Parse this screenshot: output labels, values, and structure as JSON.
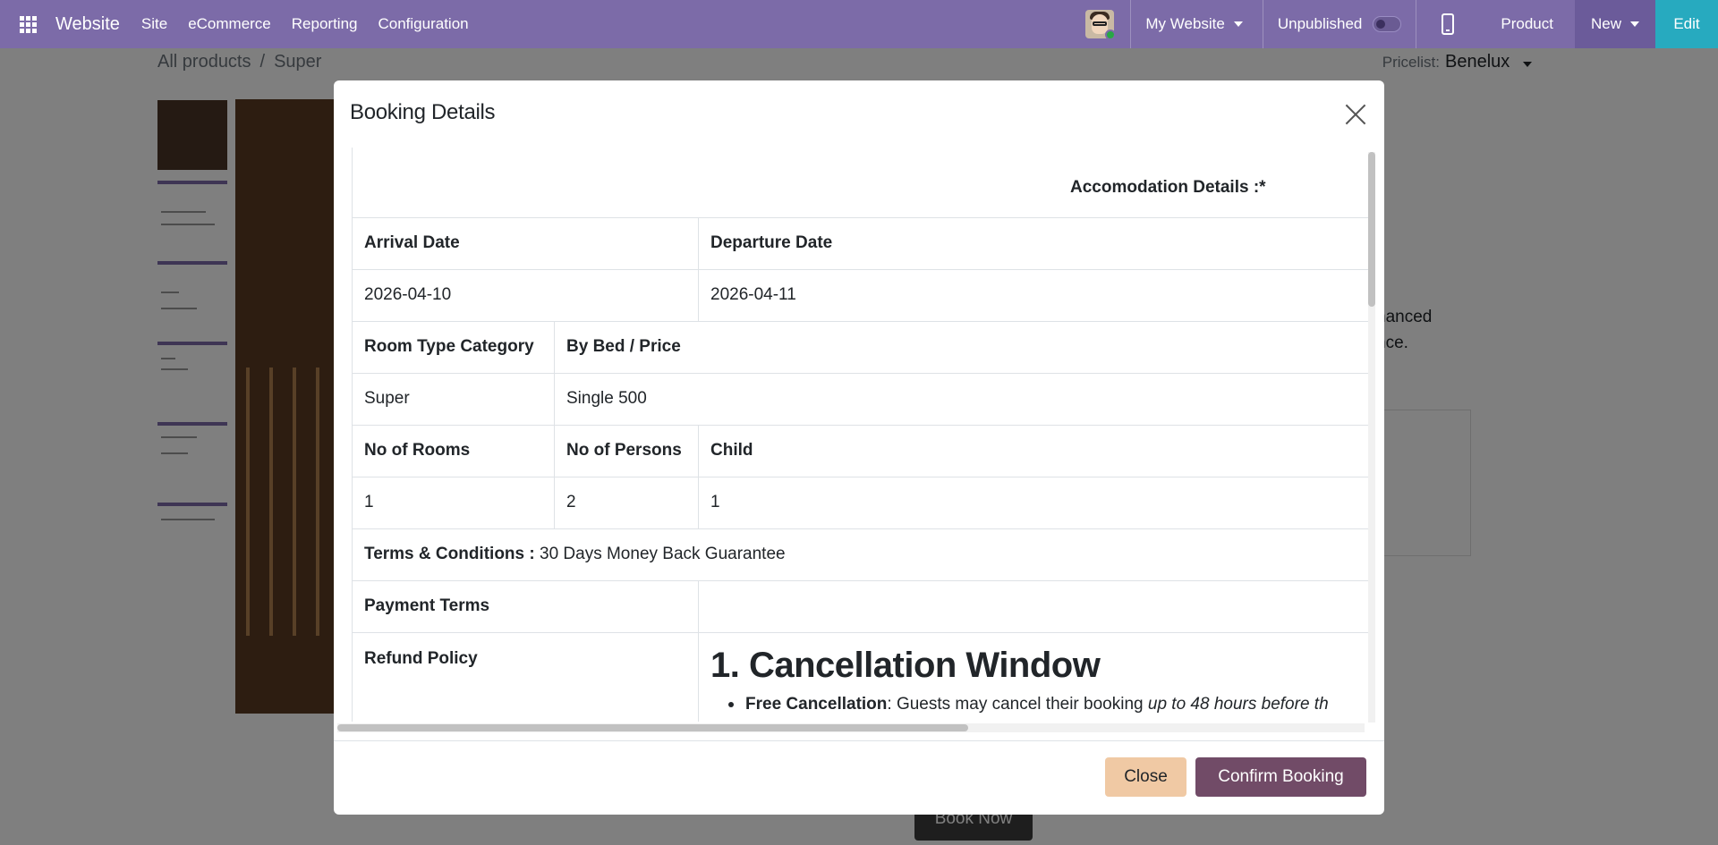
{
  "navbar": {
    "brand": "Website",
    "menu": [
      "Site",
      "eCommerce",
      "Reporting",
      "Configuration"
    ],
    "website_selector": "My Website",
    "publish_status": "Unpublished",
    "product_label": "Product",
    "new_label": "New",
    "edit_label": "Edit"
  },
  "page": {
    "breadcrumb": [
      "All products",
      "Super"
    ],
    "pricelist_label": "Pricelist:",
    "pricelist_value": "Benelux",
    "description_lines": [
      "hanced",
      "nce."
    ],
    "book_now_label": "Book Now"
  },
  "modal": {
    "title": "Booking Details",
    "accommodation_heading": "Accomodation Details :*",
    "arrival_label": "Arrival Date",
    "arrival_value": "2026-04-10",
    "departure_label": "Departure Date",
    "departure_value": "2026-04-11",
    "room_type_label": "Room Type Category",
    "price_label": "By Bed / Price",
    "room_type_value": "Super",
    "price_value": "Single 500",
    "rooms_label": "No of Rooms",
    "persons_label": "No of Persons",
    "child_label": "Child",
    "rooms_value": "1",
    "persons_value": "2",
    "child_value": "1",
    "terms_label": "Terms & Conditions :",
    "terms_value": " 30 Days Money Back Guarantee",
    "payment_terms_label": "Payment Terms",
    "refund_label": "Refund Policy",
    "cancellation_heading": "1. Cancellation Window",
    "free_cancel_label": "Free Cancellation",
    "free_cancel_text": ": Guests may cancel their booking ",
    "free_cancel_italic": "up to 48 hours before th",
    "close_label": "Close",
    "confirm_label": "Confirm Booking"
  },
  "colors": {
    "navbar": "#7c6ba8",
    "edit": "#27aabf",
    "confirm": "#714b67",
    "close": "#f0c9a4"
  }
}
